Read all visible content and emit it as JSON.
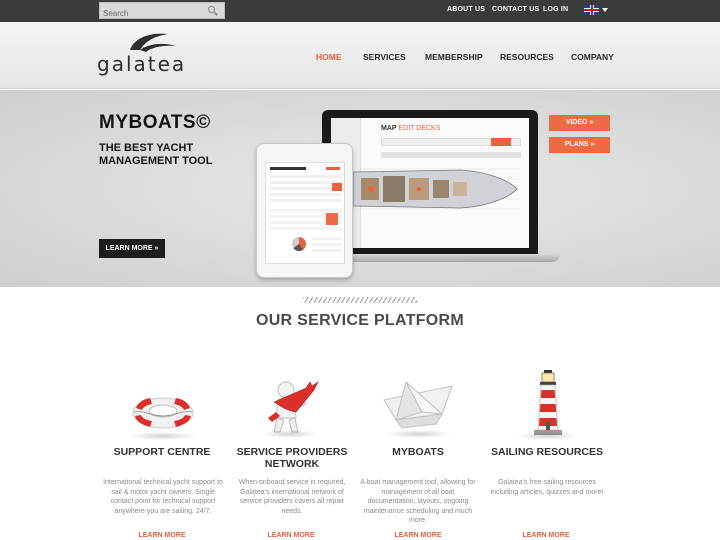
{
  "topbar": {
    "search_placeholder": "Search",
    "links": [
      "ABOUT US",
      "CONTACT US",
      "LOG IN"
    ]
  },
  "logo": {
    "text": "galatea"
  },
  "nav": {
    "items": [
      "HOME",
      "SERVICES",
      "MEMBERSHIP",
      "RESOURCES",
      "COMPANY"
    ],
    "active": "HOME"
  },
  "hero": {
    "title": "MYBOATS©",
    "subtitle": "THE BEST YACHT MANAGEMENT TOOL",
    "learn_more": "LEARN MORE »",
    "video_button": "VIDEO »",
    "plans_button": "PLANS »",
    "screen_title_main": "MAP",
    "screen_title_sub": "EDIT DECKS"
  },
  "services": {
    "title": "OUR SERVICE PLATFORM",
    "items": [
      {
        "title": "SUPPORT CENTRE",
        "text": "International technical yacht support to sail & motor yacht owners. Single contact point for technical support anywhere you are sailing, 24/7.",
        "link": "LEARN MORE",
        "icon": "lifebuoy-icon"
      },
      {
        "title": "SERVICE PROVIDERS NETWORK",
        "text": "When onboard service is required, Galatea's international network of service providers covers all repair needs.",
        "link": "LEARN MORE",
        "icon": "wrench-figure-icon"
      },
      {
        "title": "MYBOATS",
        "text": "A boat management tool, allowing for management of all boat documentation, layouts, ongoing maintenance scheduling and much more.",
        "link": "LEARN MORE",
        "icon": "paper-boat-icon"
      },
      {
        "title": "SAILING RESOURCES",
        "text": "Galatea's free sailing resources including articles, quizzes and more!",
        "link": "LEARN MORE",
        "icon": "lighthouse-icon"
      }
    ]
  },
  "colors": {
    "accent": "#e8623f",
    "topbar": "#3b3b3b",
    "button_orange": "#ec6a44"
  }
}
